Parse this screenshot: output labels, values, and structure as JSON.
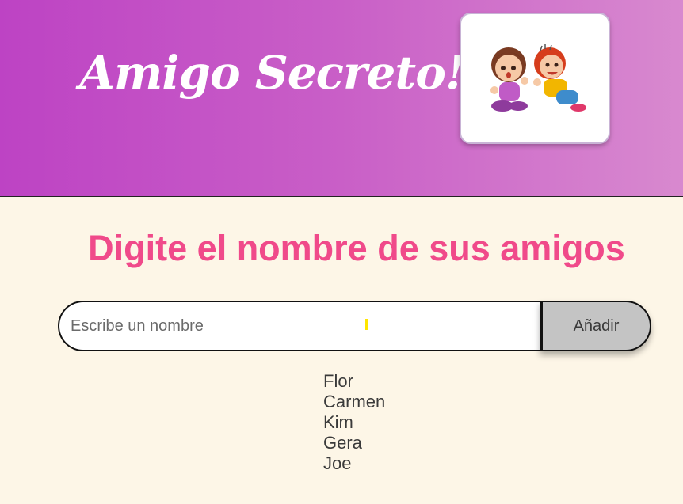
{
  "header": {
    "title": "Amigo Secreto!!",
    "image_alt": "two kids whispering illustration",
    "gradient_colors": [
      "#bd43c4",
      "#d889cf"
    ]
  },
  "main": {
    "heading": "Digite el nombre de sus amigos",
    "heading_color": "#f04a8a"
  },
  "form": {
    "input_value": "",
    "input_placeholder": "Escribe un nombre",
    "add_button_label": "Añadir"
  },
  "friends": [
    "Flor",
    "Carmen",
    "Kim",
    "Gera",
    "Joe"
  ]
}
